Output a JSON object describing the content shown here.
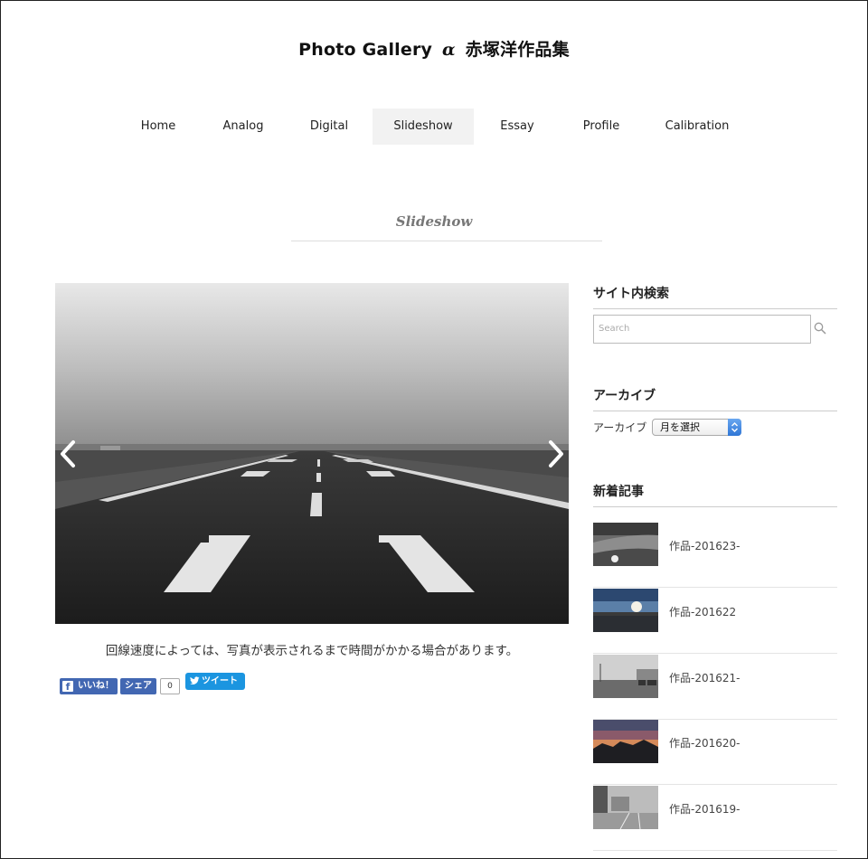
{
  "site": {
    "title_left": "Photo Gallery",
    "title_alpha": "α",
    "title_right": "赤塚洋作品集"
  },
  "nav": {
    "items": [
      {
        "label": "Home",
        "active": false
      },
      {
        "label": "Analog",
        "active": false
      },
      {
        "label": "Digital",
        "active": false
      },
      {
        "label": "Slideshow",
        "active": true
      },
      {
        "label": "Essay",
        "active": false
      },
      {
        "label": "Profile",
        "active": false
      },
      {
        "label": "Calibration",
        "active": false
      }
    ]
  },
  "page": {
    "heading": "Slideshow",
    "slide": {
      "prev_icon": "chevron-left-icon",
      "next_icon": "chevron-right-icon"
    },
    "notice": "回線速度によっては、写真が表示されるまで時間がかかる場合があります。",
    "social": {
      "fb_like": "いいね！",
      "fb_share": "シェア",
      "share_count": "0",
      "tweet": "ツイート"
    }
  },
  "sidebar": {
    "search": {
      "title": "サイト内検索",
      "placeholder": "Search"
    },
    "archive": {
      "title": "アーカイブ",
      "label": "アーカイブ",
      "selected": "月を選択"
    },
    "recent": {
      "title": "新着記事",
      "posts": [
        {
          "title": "作品-201623-"
        },
        {
          "title": "作品-201622"
        },
        {
          "title": "作品-201621-"
        },
        {
          "title": "作品-201620-"
        },
        {
          "title": "作品-201619-"
        }
      ]
    }
  },
  "colors": {
    "nav_active_bg": "#f2f2f2",
    "facebook": "#4267b2",
    "twitter": "#1b95e0"
  }
}
